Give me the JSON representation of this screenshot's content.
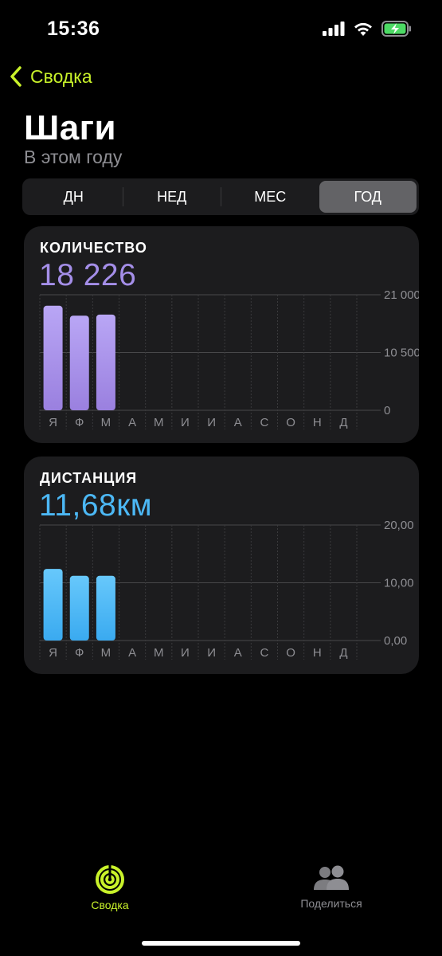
{
  "status": {
    "time": "15:36",
    "icons": [
      "signal-icon",
      "wifi-icon",
      "battery-charging-icon"
    ]
  },
  "nav": {
    "back_label": "Сводка"
  },
  "header": {
    "title": "Шаги",
    "subtitle": "В этом году"
  },
  "segments": [
    {
      "label": "ДН",
      "active": false
    },
    {
      "label": "НЕД",
      "active": false
    },
    {
      "label": "МЕС",
      "active": false
    },
    {
      "label": "ГОД",
      "active": true
    }
  ],
  "cards": {
    "steps": {
      "label": "КОЛИЧЕСТВО",
      "value": "18 226",
      "color": "#a48ee8"
    },
    "distance": {
      "label": "ДИСТАНЦИЯ",
      "value": "11,68км",
      "color": "#4cb8f5"
    }
  },
  "chart_data": [
    {
      "type": "bar",
      "categories": [
        "Я",
        "Ф",
        "М",
        "А",
        "М",
        "И",
        "И",
        "А",
        "С",
        "О",
        "Н",
        "Д"
      ],
      "values": [
        19000,
        17200,
        17400,
        null,
        null,
        null,
        null,
        null,
        null,
        null,
        null,
        null
      ],
      "ylim": [
        0,
        21000
      ],
      "ytick_labels": [
        "21 000",
        "10 500",
        "0"
      ],
      "grid": true,
      "color": "#a48ee8"
    },
    {
      "type": "bar",
      "categories": [
        "Я",
        "Ф",
        "М",
        "А",
        "М",
        "И",
        "И",
        "А",
        "С",
        "О",
        "Н",
        "Д"
      ],
      "values": [
        12.4,
        11.2,
        11.2,
        null,
        null,
        null,
        null,
        null,
        null,
        null,
        null,
        null
      ],
      "ylim": [
        0,
        20
      ],
      "ytick_labels": [
        "20,00",
        "10,00",
        "0,00"
      ],
      "grid": true,
      "color": "#4cb8f5"
    }
  ],
  "tabbar": {
    "summary_label": "Сводка",
    "share_label": "Поделиться",
    "accent": "#c9f22a"
  }
}
